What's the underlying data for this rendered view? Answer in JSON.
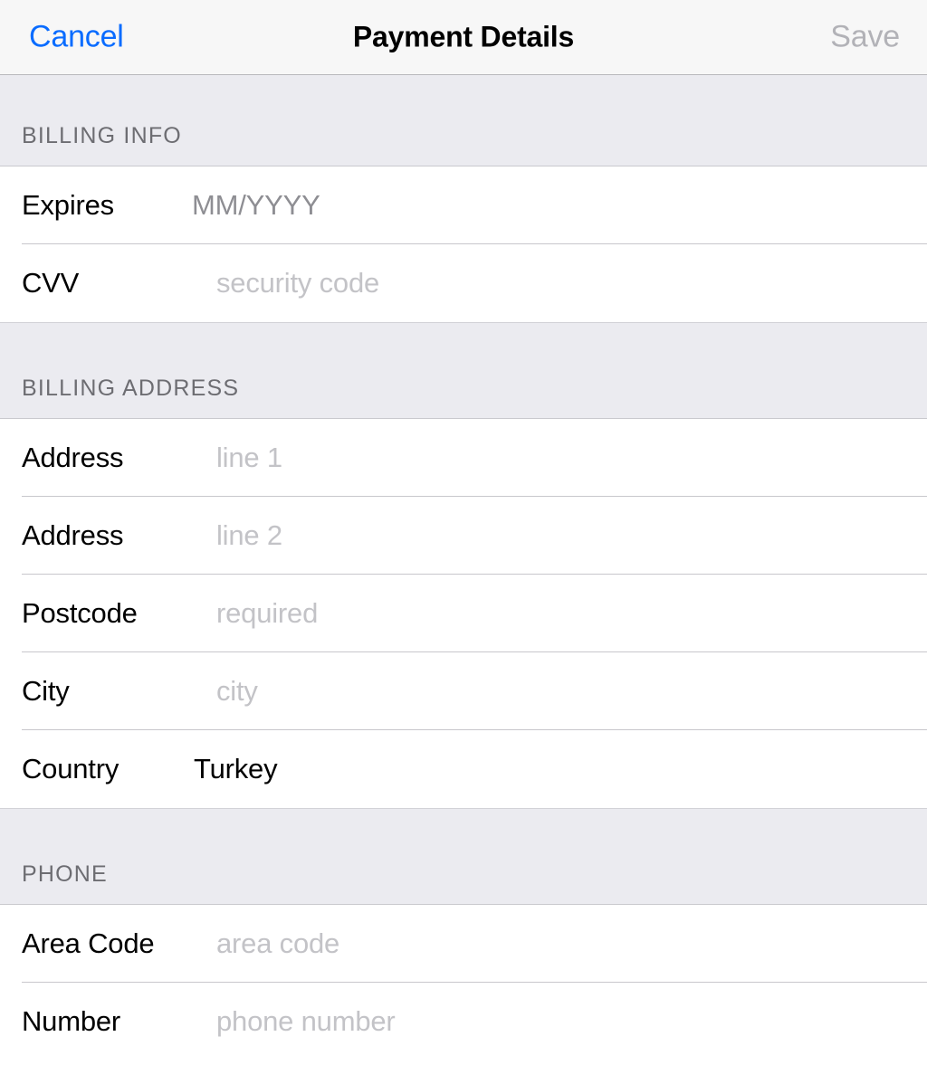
{
  "navbar": {
    "cancel_label": "Cancel",
    "title": "Payment Details",
    "save_label": "Save",
    "cancel_color": "#0a6cff",
    "save_color": "#b2b2b7",
    "save_enabled": false
  },
  "sections": [
    {
      "header": "BILLING INFO",
      "rows": [
        {
          "label": "Expires",
          "value": "MM/YYYY",
          "value_kind": "dark-placeholder"
        },
        {
          "label": "CVV",
          "value": "security code",
          "value_kind": "placeholder"
        }
      ]
    },
    {
      "header": "BILLING ADDRESS",
      "rows": [
        {
          "label": "Address",
          "value": "line 1",
          "value_kind": "placeholder"
        },
        {
          "label": "Address",
          "value": "line 2",
          "value_kind": "placeholder"
        },
        {
          "label": "Postcode",
          "value": "required",
          "value_kind": "placeholder"
        },
        {
          "label": "City",
          "value": "city",
          "value_kind": "placeholder"
        },
        {
          "label": "Country",
          "value": "Turkey",
          "value_kind": "filled"
        }
      ]
    },
    {
      "header": "PHONE",
      "rows": [
        {
          "label": "Area Code",
          "value": "area code",
          "value_kind": "placeholder"
        },
        {
          "label": "Number",
          "value": "phone number",
          "value_kind": "placeholder"
        }
      ]
    }
  ],
  "colors": {
    "navbar_background": "#f7f7f7",
    "section_header_background": "#ebebf0",
    "section_header_text": "#6d6d72",
    "row_background": "#ffffff",
    "separator": "#c8c7cc",
    "label_text": "#000000",
    "placeholder_text": "#c3c3c7",
    "dark_placeholder_text": "#8e8e93"
  }
}
